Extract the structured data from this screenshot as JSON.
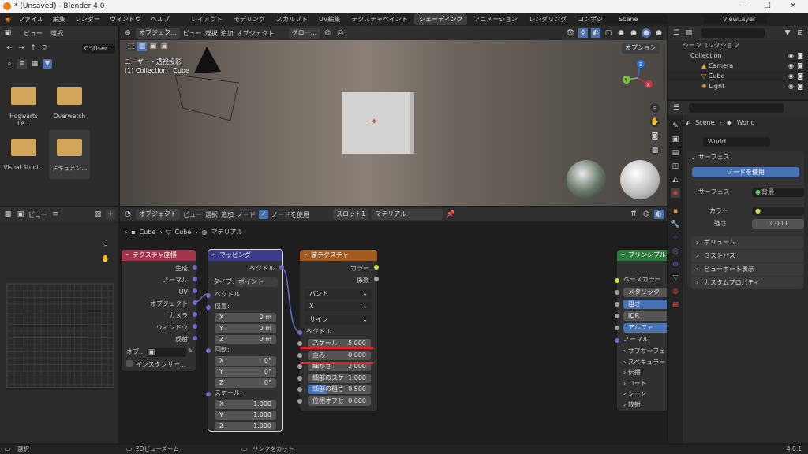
{
  "window": {
    "title": "* (Unsaved) - Blender 4.0",
    "min": "—",
    "max": "☐",
    "close": "✕"
  },
  "menu": [
    "ファイル",
    "編集",
    "レンダー",
    "ウィンドウ",
    "ヘルプ"
  ],
  "workspaces": [
    "レイアウト",
    "モデリング",
    "スカルプト",
    "UV編集",
    "テクスチャペイント",
    "シェーディング",
    "アニメーション",
    "レンダリング",
    "コンポジティング"
  ],
  "active_workspace": "シェーディング",
  "scene": "Scene",
  "view_layer": "ViewLayer",
  "filebrowser": {
    "menu": [
      "ビュー",
      "選択"
    ],
    "path": "C:\\User...",
    "items": [
      "Hogwarts Le...",
      "Overwatch",
      "Visual Studi...",
      "ドキュメン..."
    ]
  },
  "viewport": {
    "mode": "オブジェク...",
    "menu": [
      "ビュー",
      "選択",
      "追加",
      "オブジェクト"
    ],
    "orientation": "グロー...",
    "options": "オプション",
    "info1": "ユーザー・透視投影",
    "info2": "(1) Collection | Cube",
    "axis_x": "X",
    "axis_y": "Y",
    "axis_z": "Z"
  },
  "outliner": {
    "header": "シーンコレクション",
    "items": [
      "Collection",
      "Camera",
      "Cube",
      "Light"
    ]
  },
  "properties": {
    "breadcrumb_scene": "Scene",
    "breadcrumb_world": "World",
    "world_name": "World",
    "surface_panel": "サーフェス",
    "use_nodes": "ノードを使用",
    "surface_label": "サーフェス",
    "surface_value": "背景",
    "color_label": "カラー",
    "strength_label": "強さ",
    "strength_value": "1.000",
    "panels": [
      "ボリューム",
      "ミストパス",
      "ビューポート表示",
      "カスタムプロパティ"
    ]
  },
  "imageeditor": {
    "view": "ビュー"
  },
  "nodeeditor": {
    "mode": "オブジェクト",
    "menu": [
      "ビュー",
      "選択",
      "追加",
      "ノード"
    ],
    "use_nodes": "ノードを使用",
    "slot": "スロット1",
    "material": "マテリアル",
    "breadcrumb": [
      "Cube",
      "Cube",
      "マテリアル"
    ]
  },
  "node_texcoord": {
    "title": "テクスチャ座標",
    "outputs": [
      "生成",
      "ノーマル",
      "UV",
      "オブジェクト",
      "カメラ",
      "ウィンドウ",
      "反射"
    ],
    "object_label": "オブ...",
    "instancer": "インスタンサー..."
  },
  "node_mapping": {
    "title": "マッピング",
    "output": "ベクトル",
    "type_label": "タイプ:",
    "type_value": "ポイント",
    "vector": "ベクトル",
    "location": "位置:",
    "rotation": "回転:",
    "scale": "スケール:",
    "loc": [
      [
        "X",
        "0 m"
      ],
      [
        "Y",
        "0 m"
      ],
      [
        "Z",
        "0 m"
      ]
    ],
    "rot": [
      [
        "X",
        "0°"
      ],
      [
        "Y",
        "0°"
      ],
      [
        "Z",
        "0°"
      ]
    ],
    "scl": [
      [
        "X",
        "1.000"
      ],
      [
        "Y",
        "1.000"
      ],
      [
        "Z",
        "1.000"
      ]
    ]
  },
  "node_wave": {
    "title": "波テクスチャ",
    "outputs": [
      "カラー",
      "係数"
    ],
    "type": "バンド",
    "axis": "X",
    "profile": "サイン",
    "vector": "ベクトル",
    "params": [
      [
        "スケール",
        "5.000"
      ],
      [
        "歪み",
        "0.000"
      ],
      [
        "細かさ",
        "2.000"
      ],
      [
        "細部のスケ",
        "1.000"
      ],
      [
        "細部の粗さ",
        "0.500"
      ],
      [
        "位相オフセ",
        "0.000"
      ]
    ]
  },
  "node_principled": {
    "title": "プリンシプル",
    "base_color": "ベースカラー",
    "metallic": "メタリック",
    "roughness": "粗さ",
    "ior": "IOR",
    "alpha": "アルファ",
    "normal": "ノーマル",
    "panels": [
      "サブサーフェ",
      "スペキュラー",
      "伝播",
      "コート",
      "シーン",
      "放射"
    ]
  },
  "status": {
    "left": "選択",
    "mid": "2Dビューズーム",
    "right": "リンクをカット",
    "version": "4.0.1"
  },
  "colors": {
    "accent": "#4772b3",
    "texcoord": "#a3334a",
    "mapping": "#3b3b87",
    "wave": "#a35a1e",
    "shader": "#2b7a3c",
    "underline": "#e8202a"
  }
}
